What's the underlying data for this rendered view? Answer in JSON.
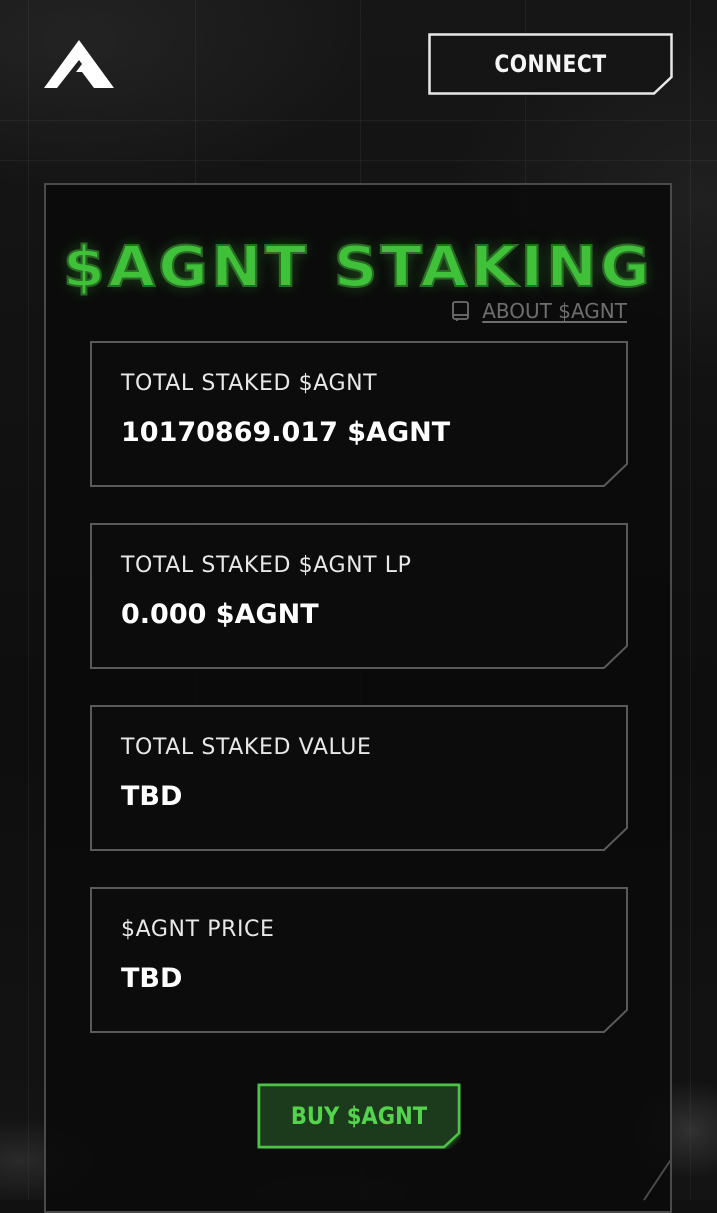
{
  "header": {
    "connect_label": "CONNECT"
  },
  "staking": {
    "title": "$AGNT STAKING",
    "about_label": "ABOUT $AGNT",
    "stats": [
      {
        "label": "TOTAL STAKED $AGNT",
        "value": "10170869.017 $AGNT"
      },
      {
        "label": "TOTAL STAKED $AGNT LP",
        "value": "0.000 $AGNT"
      },
      {
        "label": "TOTAL STAKED VALUE",
        "value": "TBD"
      },
      {
        "label": "$AGNT PRICE",
        "value": "TBD"
      }
    ],
    "buy_label": "BUY $AGNT"
  },
  "icons": {
    "logo": "agnt-logo-icon",
    "about": "book-icon"
  },
  "colors": {
    "accent_green": "#3fc23a",
    "background": "#111111",
    "panel": "#0d0d0d",
    "border": "#5a5a5a"
  }
}
